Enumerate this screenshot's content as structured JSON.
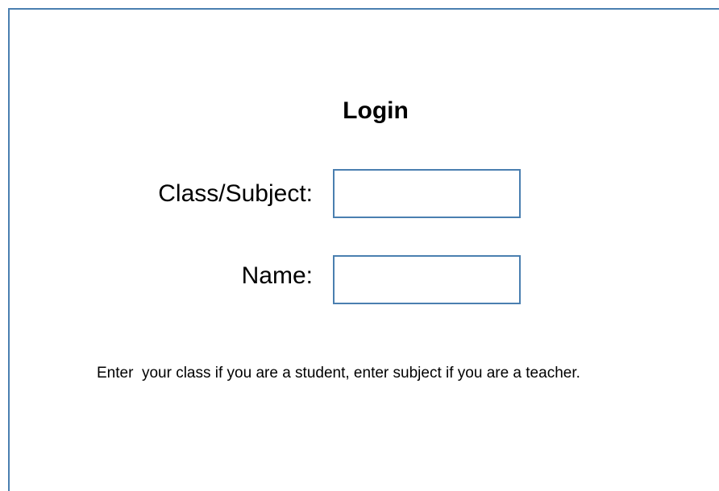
{
  "login": {
    "title": "Login",
    "class_subject_label": "Class/Subject:",
    "class_subject_value": "",
    "name_label": "Name:",
    "name_value": "",
    "hint": "Enter  your class if you are a student, enter subject if you are a teacher."
  },
  "colors": {
    "border_accent": "#4a7fb0"
  }
}
